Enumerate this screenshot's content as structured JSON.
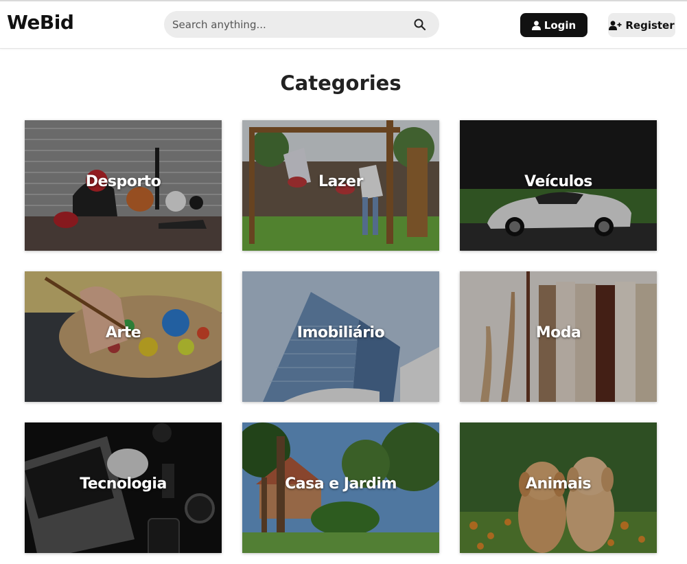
{
  "header": {
    "logo": "WeBid",
    "search_placeholder": "Search anything...",
    "login_label": "Login",
    "register_label": "Register"
  },
  "page": {
    "title": "Categories"
  },
  "categories": [
    {
      "label": "Desporto",
      "image": "sports-equipment"
    },
    {
      "label": "Lazer",
      "image": "playground-swing"
    },
    {
      "label": "Veículos",
      "image": "white-sports-car"
    },
    {
      "label": "Arte",
      "image": "paint-palette"
    },
    {
      "label": "Imobiliário",
      "image": "office-building"
    },
    {
      "label": "Moda",
      "image": "clothing-rack"
    },
    {
      "label": "Tecnologia",
      "image": "laptop-desk"
    },
    {
      "label": "Casa e Jardim",
      "image": "house-garden"
    },
    {
      "label": "Animais",
      "image": "puppies"
    }
  ],
  "colors": {
    "login_bg": "#111111",
    "register_bg": "#ececec",
    "search_bg": "#ececec"
  }
}
